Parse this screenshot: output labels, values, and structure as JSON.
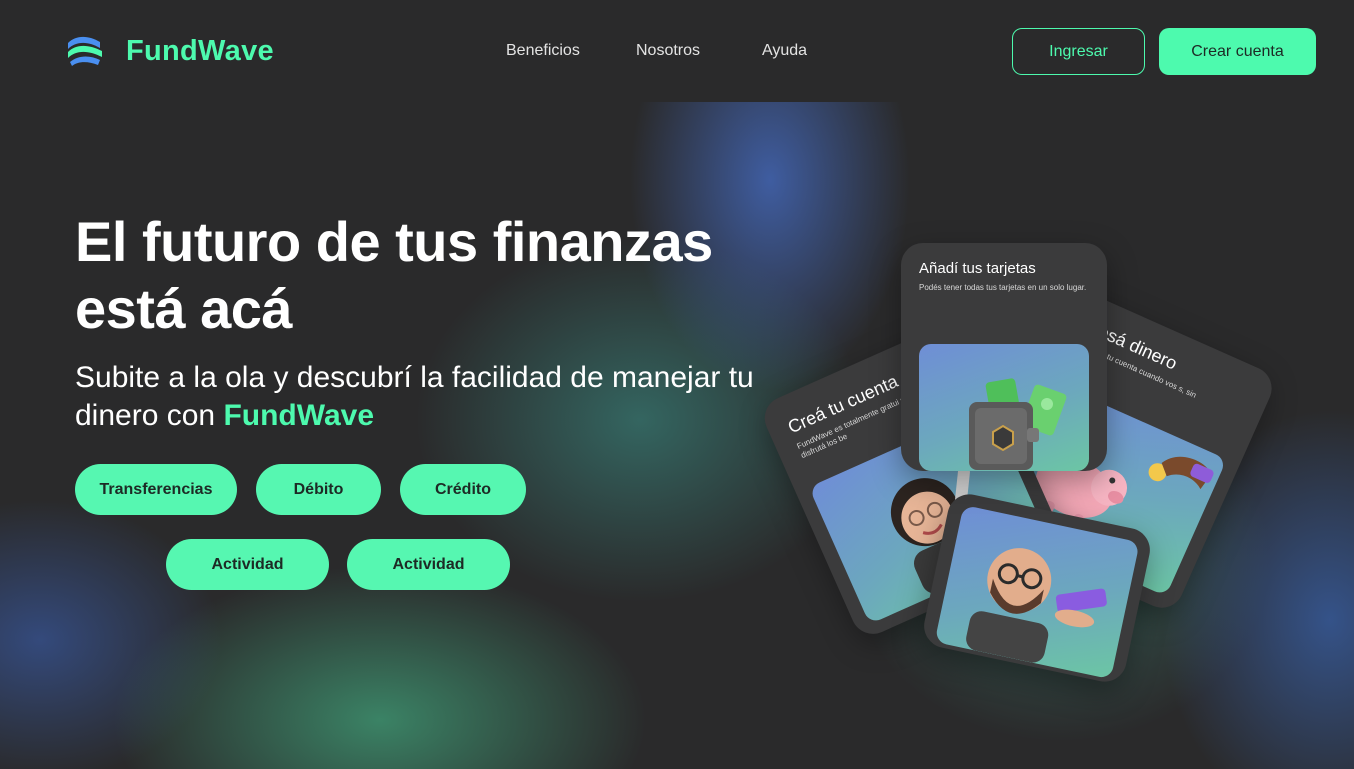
{
  "brand": {
    "name": "FundWave",
    "accent": "#4dfaae",
    "background": "#2a2a2b"
  },
  "nav": {
    "items": [
      {
        "label": "Beneficios"
      },
      {
        "label": "Nosotros"
      },
      {
        "label": "Ayuda"
      }
    ]
  },
  "auth": {
    "login_label": "Ingresar",
    "signup_label": "Crear cuenta"
  },
  "hero": {
    "title": "El futuro de tus finanzas está acá",
    "subtitle_prefix": "Subite a la ola y descubrí la facilidad de manejar tu dinero con",
    "subtitle_brand": "FundWave",
    "chips": [
      {
        "label": "Transferencias"
      },
      {
        "label": "Débito"
      },
      {
        "label": "Crédito"
      },
      {
        "label": "Actividad"
      },
      {
        "label": "Actividad"
      }
    ]
  },
  "cards": {
    "create": {
      "title": "Creá tu cuenta grat",
      "desc": "FundWave es totalmente gratui propia cuenta y disfrutá los be"
    },
    "cards": {
      "title": "Añadí tus tarjetas",
      "desc": "Podés tener todas tus tarjetas en un solo lugar."
    },
    "deposit": {
      "title": "Ingresá dinero",
      "desc": "resá dinero a tu cuenta cuando vos s, sin cargo."
    },
    "bottom": {
      "title": ""
    }
  },
  "icons": {
    "logo": "wave-logo-icon",
    "wallet": "wallet-icon",
    "piggy": "piggy-bank-icon",
    "avatar_woman": "avatar-woman-icon",
    "avatar_man": "avatar-man-icon",
    "card": "credit-card-icon"
  }
}
